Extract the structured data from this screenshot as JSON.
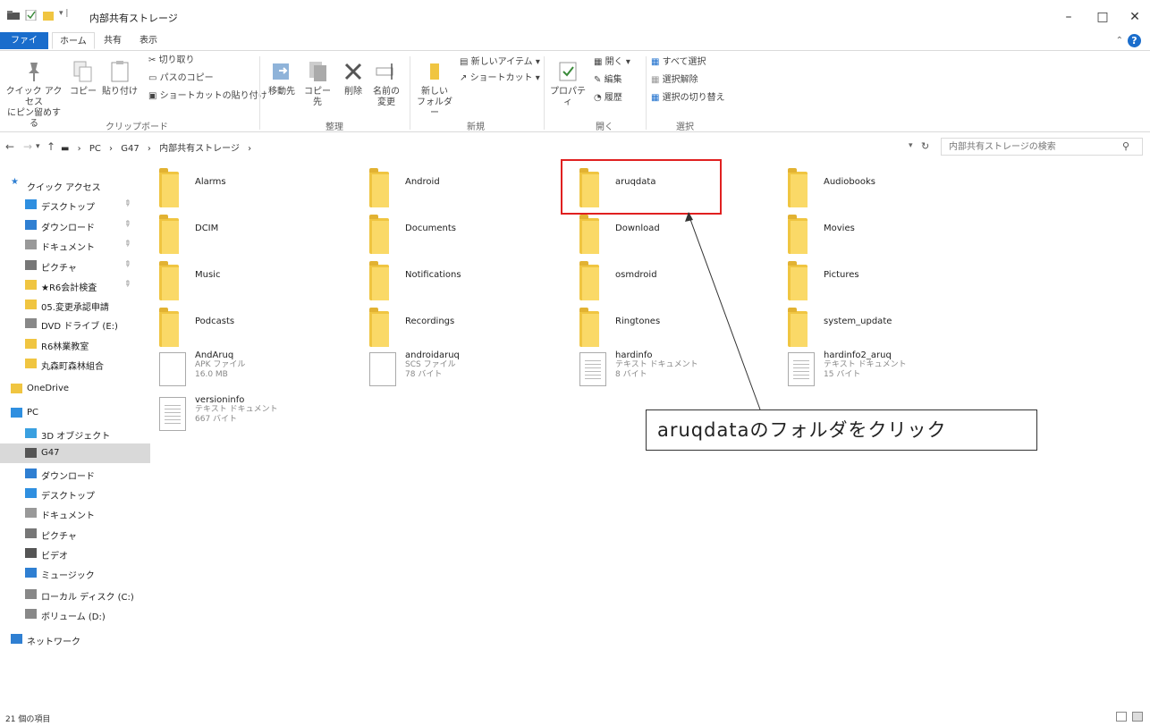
{
  "window": {
    "title": "内部共有ストレージ",
    "minimize": "–",
    "maximize": "□",
    "close": "✕"
  },
  "ribbon_tabs": [
    "ファイル",
    "ホーム",
    "共有",
    "表示"
  ],
  "ribbon": {
    "pin_label_1": "クイック アクセス",
    "pin_label_2": "にピン留めする",
    "copy": "コピー",
    "paste": "貼り付け",
    "cut": "切り取り",
    "copy_path": "パスのコピー",
    "paste_shortcut": "ショートカットの貼り付け",
    "move_to": "移動先",
    "copy_to": "コピー先",
    "delete": "削除",
    "rename_1": "名前の",
    "rename_2": "変更",
    "new_folder_1": "新しい",
    "new_folder_2": "フォルダー",
    "new_item": "新しいアイテム ▾",
    "shortcut": "ショートカット ▾",
    "properties": "プロパティ",
    "open": "開く ▾",
    "edit": "編集",
    "history": "履歴",
    "select_all": "すべて選択",
    "select_none": "選択解除",
    "invert_selection": "選択の切り替え",
    "groups": {
      "clipboard": "クリップボード",
      "organize": "整理",
      "new": "新規",
      "open": "開く",
      "select": "選択"
    }
  },
  "address": {
    "back": "←",
    "forward": "→",
    "recent": "▾",
    "up": "↑",
    "breadcrumb": [
      "PC",
      "G47",
      "内部共有ストレージ"
    ],
    "separator": "›",
    "refresh": "↻",
    "search_placeholder": "内部共有ストレージの検索"
  },
  "nav": [
    {
      "label": "クイック アクセス",
      "icon": "star-icon",
      "pinned": false
    },
    {
      "label": "デスクトップ",
      "icon": "desktop-icon",
      "pinned": true
    },
    {
      "label": "ダウンロード",
      "icon": "download-icon",
      "pinned": true
    },
    {
      "label": "ドキュメント",
      "icon": "document-icon",
      "pinned": true
    },
    {
      "label": "ピクチャ",
      "icon": "picture-icon",
      "pinned": true
    },
    {
      "label": "★R6会計検査",
      "icon": "folder-icon",
      "pinned": true
    },
    {
      "label": "05.変更承認申請",
      "icon": "folder-icon",
      "pinned": false
    },
    {
      "label": "DVD ドライブ (E:)",
      "icon": "dvd-icon",
      "pinned": false
    },
    {
      "label": "R6林業教室",
      "icon": "folder-icon",
      "pinned": false
    },
    {
      "label": "丸森町森林組合",
      "icon": "folder-icon",
      "pinned": false
    },
    {
      "label": "OneDrive",
      "icon": "onedrive-icon",
      "pinned": false
    },
    {
      "label": "PC",
      "icon": "pc-icon",
      "pinned": false
    },
    {
      "label": "3D オブジェクト",
      "icon": "3d-objects-icon",
      "pinned": false
    },
    {
      "label": "G47",
      "icon": "phone-icon",
      "pinned": false
    },
    {
      "label": "ダウンロード",
      "icon": "download-icon",
      "pinned": false
    },
    {
      "label": "デスクトップ",
      "icon": "desktop-icon",
      "pinned": false
    },
    {
      "label": "ドキュメント",
      "icon": "document-icon",
      "pinned": false
    },
    {
      "label": "ピクチャ",
      "icon": "picture-icon",
      "pinned": false
    },
    {
      "label": "ビデオ",
      "icon": "video-icon",
      "pinned": false
    },
    {
      "label": "ミュージック",
      "icon": "music-icon",
      "pinned": false
    },
    {
      "label": "ローカル ディスク (C:)",
      "icon": "disk-icon",
      "pinned": false
    },
    {
      "label": "ボリューム (D:)",
      "icon": "disk-icon",
      "pinned": false
    },
    {
      "label": "ネットワーク",
      "icon": "network-icon",
      "pinned": false
    }
  ],
  "pin_glyph": "📌",
  "folders": [
    "Alarms",
    "Android",
    "aruqdata",
    "Audiobooks",
    "DCIM",
    "Documents",
    "Download",
    "Movies",
    "Music",
    "Notifications",
    "osmdroid",
    "Pictures",
    "Podcasts",
    "Recordings",
    "Ringtones",
    "system_update"
  ],
  "files": [
    {
      "name": "AndAruq",
      "type": "APK ファイル",
      "size": "16.0 MB",
      "icon": "file-icon"
    },
    {
      "name": "androidaruq",
      "type": "SCS ファイル",
      "size": "78 バイト",
      "icon": "file-icon"
    },
    {
      "name": "hardinfo",
      "type": "テキスト ドキュメント",
      "size": "8 バイト",
      "icon": "text-file-icon"
    },
    {
      "name": "hardinfo2_aruq",
      "type": "テキスト ドキュメント",
      "size": "15 バイト",
      "icon": "text-file-icon"
    },
    {
      "name": "versioninfo",
      "type": "テキスト ドキュメント",
      "size": "667 バイト",
      "icon": "text-file-icon"
    }
  ],
  "annotation": {
    "callout_text": "aruqdataのフォルダをクリック",
    "highlight_color": "#e02020"
  },
  "status": {
    "item_count": "21 個の項目"
  },
  "colors": {
    "accent": "#1a6dcc",
    "folder": "#f0c541",
    "selected_nav": "#d9d9d9"
  }
}
